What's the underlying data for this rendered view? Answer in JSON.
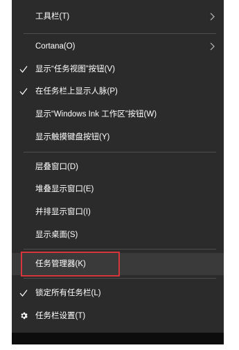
{
  "menu": {
    "items": [
      {
        "label": "工具栏(T)",
        "has_submenu": true,
        "checked": false
      },
      {
        "label": "Cortana(O)",
        "has_submenu": true,
        "checked": false
      },
      {
        "label": "显示“任务视图”按钮(V)",
        "has_submenu": false,
        "checked": true
      },
      {
        "label": "在任务栏上显示人脉(P)",
        "has_submenu": false,
        "checked": true
      },
      {
        "label": "显示“Windows Ink 工作区”按钮(W)",
        "has_submenu": false,
        "checked": false
      },
      {
        "label": "显示触摸键盘按钮(Y)",
        "has_submenu": false,
        "checked": false
      },
      {
        "label": "层叠窗口(D)",
        "has_submenu": false,
        "checked": false
      },
      {
        "label": "堆叠显示窗口(E)",
        "has_submenu": false,
        "checked": false
      },
      {
        "label": "并排显示窗口(I)",
        "has_submenu": false,
        "checked": false
      },
      {
        "label": "显示桌面(S)",
        "has_submenu": false,
        "checked": false
      },
      {
        "label": "任务管理器(K)",
        "has_submenu": false,
        "checked": false,
        "highlighted": true
      },
      {
        "label": "锁定所有任务栏(L)",
        "has_submenu": false,
        "checked": true
      },
      {
        "label": "任务栏设置(T)",
        "has_submenu": false,
        "checked": false,
        "icon": "gear-icon"
      }
    ]
  },
  "colors": {
    "menu_background": "#2b2b2b",
    "text": "#ffffff",
    "separator": "#4e4e4e",
    "highlight_box": "#d9333b"
  }
}
